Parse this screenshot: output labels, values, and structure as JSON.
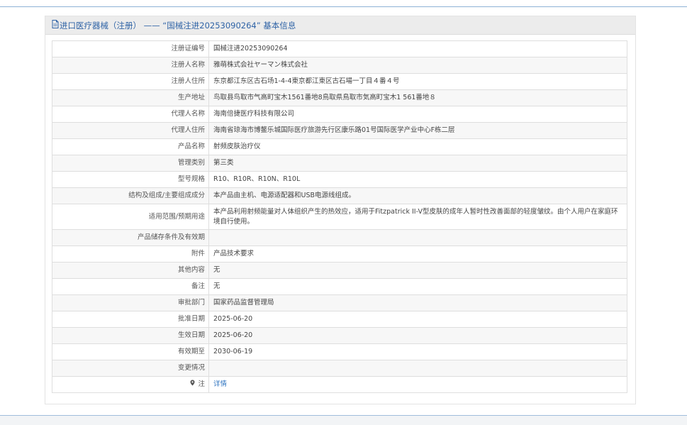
{
  "panel": {
    "header_icon": "document-icon",
    "title": "进口医疗器械（注册） —— “国械注进20253090264” 基本信息"
  },
  "rows": [
    {
      "label": "注册证编号",
      "value": "国械注进20253090264"
    },
    {
      "label": "注册人名称",
      "value": "雅萌株式会社ヤーマン株式会社"
    },
    {
      "label": "注册人住所",
      "value": "东京都江东区古石场1-4-4東京都江東区古石場一丁目４番４号"
    },
    {
      "label": "生产地址",
      "value": "鸟取县鸟取市气高町宝木1561番地8鳥取県鳥取市気高町宝木1 561番地８"
    },
    {
      "label": "代理人名称",
      "value": "海南倍捷医疗科技有限公司"
    },
    {
      "label": "代理人住所",
      "value": "海南省琼海市博鳌乐城国际医疗旅游先行区康乐路01号国际医学产业中心F栋二层"
    },
    {
      "label": "产品名称",
      "value": "射频皮肤治疗仪"
    },
    {
      "label": "管理类别",
      "value": "第三类"
    },
    {
      "label": "型号规格",
      "value": "R10、R10R、R10N、R10L"
    },
    {
      "label": "结构及组成/主要组成成分",
      "value": "本产品由主机、电源适配器和USB电源线组成。"
    },
    {
      "label": "适用范围/预期用途",
      "value": "本产品利用射频能量对人体组织产生的热效应，适用于Fitzpatrick II-V型皮肤的成年人暂时性改善面部的轻度皱纹。由个人用户在家庭环境自行使用。"
    },
    {
      "label": "产品储存条件及有效期",
      "value": ""
    },
    {
      "label": "附件",
      "value": "产品技术要求"
    },
    {
      "label": "其他内容",
      "value": "无"
    },
    {
      "label": "备注",
      "value": "无"
    },
    {
      "label": "审批部门",
      "value": "国家药品监督管理局"
    },
    {
      "label": "批准日期",
      "value": "2025-06-20"
    },
    {
      "label": "生效日期",
      "value": "2025-06-20"
    },
    {
      "label": "有效期至",
      "value": "2030-06-19"
    },
    {
      "label": "变更情况",
      "value": ""
    }
  ],
  "note": {
    "icon": "map-pin-icon",
    "label": "注",
    "link_text": "详情"
  },
  "colors": {
    "header_text": "#2f63a6",
    "link": "#2f74c0",
    "row_alt": "#f7f7f7",
    "border": "#dedede"
  }
}
